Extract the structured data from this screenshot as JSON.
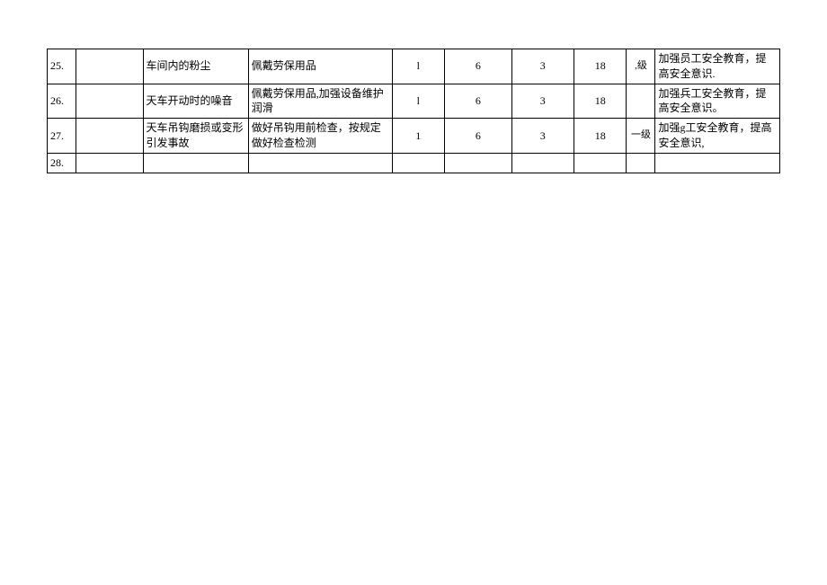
{
  "rows": [
    {
      "idx": "25.",
      "blank": "",
      "desc": "车间内的粉尘",
      "measure": "佩戴劳保用品",
      "l": "l",
      "e": "6",
      "c": "3",
      "d": "18",
      "lvl": ",级",
      "note": "加强员工安全教育，提高安全意识."
    },
    {
      "idx": "26.",
      "blank": "",
      "desc": "天车开动时的噪音",
      "measure": "佩戴劳保用品,加强设备维护润滑",
      "l": "l",
      "e": "6",
      "c": "3",
      "d": "18",
      "lvl": "",
      "note": "加强兵工安全教育，提高安全意识。"
    },
    {
      "idx": "27.",
      "blank": "",
      "desc": "天车吊钩磨损或变形引发事故",
      "measure": "做好吊钩用前检查，按规定做好检查检测",
      "l": "1",
      "e": "6",
      "c": "3",
      "d": "18",
      "lvl": "一级",
      "note": "加强g工安全教育，提高安全意识,"
    },
    {
      "idx": "28.",
      "blank": "",
      "desc": "",
      "measure": "",
      "l": "",
      "e": "",
      "c": "",
      "d": "",
      "lvl": "",
      "note": ""
    }
  ]
}
